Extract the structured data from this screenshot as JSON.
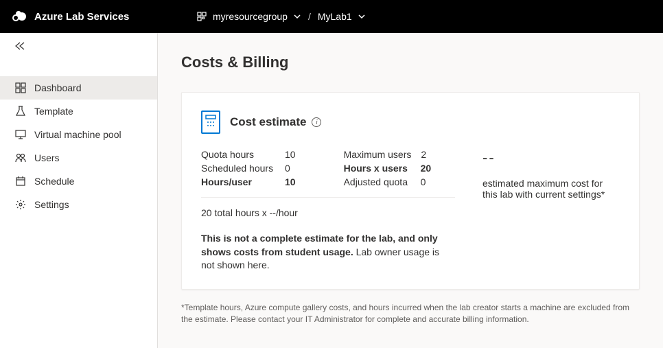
{
  "header": {
    "product_name": "Azure Lab Services",
    "resource_group": "myresourcegroup",
    "lab_name": "MyLab1"
  },
  "sidebar": {
    "items": [
      {
        "label": "Dashboard"
      },
      {
        "label": "Template"
      },
      {
        "label": "Virtual machine pool"
      },
      {
        "label": "Users"
      },
      {
        "label": "Schedule"
      },
      {
        "label": "Settings"
      }
    ]
  },
  "page": {
    "title": "Costs & Billing"
  },
  "cost_estimate": {
    "card_title": "Cost estimate",
    "metrics": {
      "quota_hours_label": "Quota hours",
      "quota_hours_value": "10",
      "scheduled_hours_label": "Scheduled hours",
      "scheduled_hours_value": "0",
      "hours_per_user_label": "Hours/user",
      "hours_per_user_value": "10",
      "max_users_label": "Maximum users",
      "max_users_value": "2",
      "hours_x_users_label": "Hours x users",
      "hours_x_users_value": "20",
      "adjusted_quota_label": "Adjusted quota",
      "adjusted_quota_value": "0"
    },
    "calc_line": "20 total hours x --/hour",
    "note_bold": "This is not a complete estimate for the lab, and only shows costs from student usage.",
    "note_rest": " Lab owner usage is not shown here.",
    "est_cost_value": "--",
    "est_cost_caption": "estimated maximum cost for this lab with current settings*"
  },
  "disclaimer": "*Template hours, Azure compute gallery costs, and hours incurred when the lab creator starts a machine are excluded from the estimate. Please contact your IT Administrator for complete and accurate billing information."
}
